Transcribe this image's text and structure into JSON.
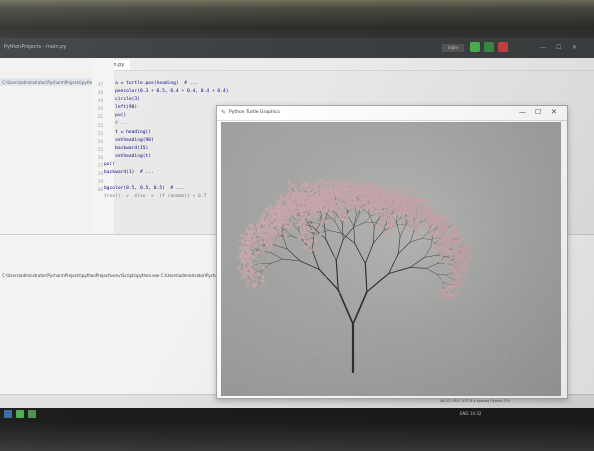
{
  "ide": {
    "window_title": "PythonProjects - main.py",
    "run_config": "main",
    "left_panel": {
      "project_path": "C:\\Users\\adminstrator\\PycharmProjects\\pythonProject"
    },
    "tab": {
      "label": "main.py"
    },
    "line_numbers": [
      "47",
      "48",
      "49",
      "50",
      "51",
      "52",
      "53",
      "54",
      "55",
      "56",
      "57",
      "58",
      "59",
      "60"
    ],
    "code_lines": [
      "    a = turtle.pos(heading)  # ...",
      "    pencolor(0.3 + 0.5, 0.4 + 0.4, 0.4 + 0.4)",
      "    circle(3)",
      "    left(90)",
      "    pu()",
      "    # ...",
      "    t = heading()",
      "    setheading(90)",
      "    backward(15)",
      "    setheading(t)",
      "pu()",
      "backward(1)  # ...",
      "",
      "bgcolor(0.5, 0.5, 0.5)  # ..."
    ],
    "breadcrumb": "tree()  >  else  >  if random() < 0.7",
    "terminal_cmd": "C:\\Users\\adminstrator\\PycharmProjects\\pythonProject\\venv\\Scripts\\python.exe C:\\Users\\adminstrator\\PycharmProjects\\pythonProject\\main.py",
    "status_text": "48:22   CRLF   UTF-8   4 spaces   Python 3.9",
    "taskbar_tray": "ENG   14:32"
  },
  "turtle_window": {
    "title": "Python Turtle Graphics",
    "min_glyph": "—",
    "max_glyph": "☐",
    "close_glyph": "✕",
    "canvas_bg": "#a9aaa8",
    "branch_color": "#2e302e",
    "blossom_color": "#c9a8ad"
  }
}
